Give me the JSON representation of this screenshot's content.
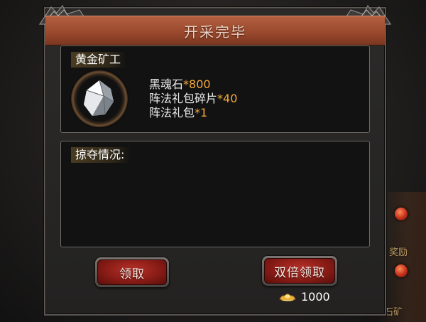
{
  "dialog": {
    "title": "开采完毕"
  },
  "mine": {
    "name": "黄金矿工",
    "icon": "crystal-ore-icon",
    "rewards": [
      {
        "item": "黑魂石",
        "qty": "*800"
      },
      {
        "item": "阵法礼包碎片",
        "qty": "*40"
      },
      {
        "item": "阵法礼包",
        "qty": "*1"
      }
    ]
  },
  "loot": {
    "label": "掠夺情况:"
  },
  "buttons": {
    "claim_label": "领取",
    "double_label": "双倍领取"
  },
  "cost": {
    "icon": "gold-ingot-icon",
    "amount": "1000"
  },
  "background": {
    "label_1": "奖励",
    "label_2": "黑魂石矿"
  },
  "colors": {
    "title_bar": "#9b4a2e",
    "button": "#8a1c16",
    "quantity": "#f0a93a"
  }
}
